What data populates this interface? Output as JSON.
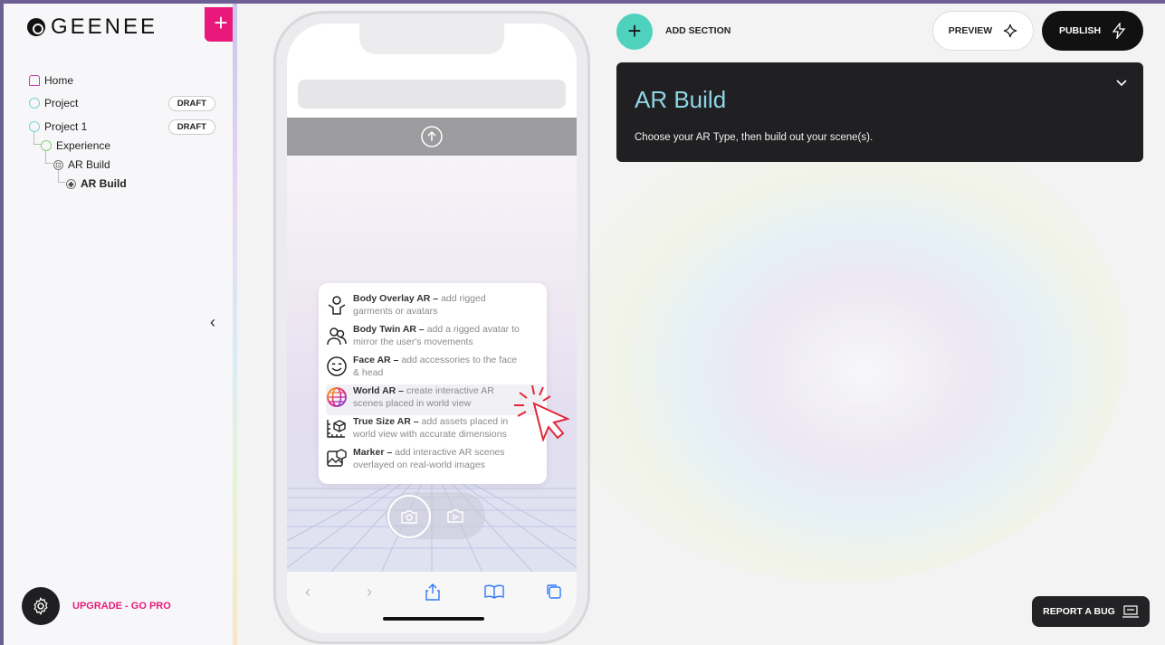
{
  "brand": {
    "logo_text": "GEENEE"
  },
  "sidebar": {
    "items": [
      {
        "label": "Home"
      },
      {
        "label": "Project",
        "badge": "DRAFT"
      },
      {
        "label": "Project 1",
        "badge": "DRAFT"
      },
      {
        "label": "Experience"
      },
      {
        "label": "AR Build"
      },
      {
        "label": "AR Build"
      }
    ],
    "upgrade_label": "UPGRADE - GO PRO"
  },
  "toolbar": {
    "add_section_label": "ADD SECTION",
    "preview_label": "PREVIEW",
    "publish_label": "PUBLISH"
  },
  "card": {
    "title": "AR Build",
    "subtitle": "Choose your AR Type, then build out your scene(s)."
  },
  "ar_types": [
    {
      "name": "Body Overlay AR –",
      "desc_first": "add rigged",
      "desc_rest": "garments or avatars",
      "icon": "person-outline-icon"
    },
    {
      "name": "Body Twin AR –",
      "desc_first": "add a rigged avatar to",
      "desc_rest": "mirror the user's movements",
      "icon": "two-people-icon"
    },
    {
      "name": "Face AR –",
      "desc_first": "add accessories to the face",
      "desc_rest": "& head",
      "icon": "smiley-icon"
    },
    {
      "name": "World AR –",
      "desc_first": "create interactive AR",
      "desc_rest": "scenes placed in world view",
      "icon": "globe-icon"
    },
    {
      "name": "True Size AR –",
      "desc_first": "add assets placed in",
      "desc_rest": "world view with accurate dimensions",
      "icon": "ruler-cube-icon"
    },
    {
      "name": "Marker –",
      "desc_first": "add interactive AR scenes",
      "desc_rest": "overlayed on real-world images",
      "icon": "image-marker-icon"
    }
  ],
  "report_bug_label": "REPORT A BUG",
  "colors": {
    "accent_pink": "#e8197b",
    "accent_teal": "#4ed2be",
    "card_bg": "#202022",
    "title_blue": "#8fd6e6"
  }
}
